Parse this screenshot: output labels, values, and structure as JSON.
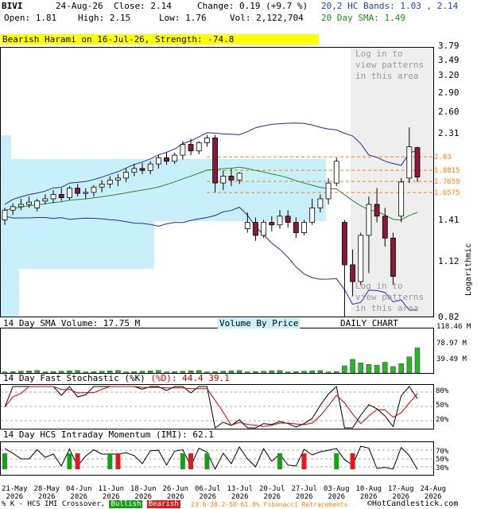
{
  "header": {
    "symbol": "BIVI",
    "date": "24-Aug-26",
    "close_label": "Close: 2.14",
    "change_label": "Change: 0.19 (+9.7 %)",
    "open_label": "Open: 1.81",
    "high_label": "High: 2.15",
    "low_label": "Low: 1.76",
    "vol_label": "Vol: 2,122,704",
    "bands_label": "20,2 HC Bands: 1.03 , 2.14",
    "sma_label": "20 Day SMA: 1.49"
  },
  "pattern_banner": "Bearish Harami on 16-Jul-26, Strength: -74.8",
  "login_notes": [
    "Log in to",
    "view patterns",
    "in this area"
  ],
  "price_axis": {
    "ticks": [
      "3.79",
      "3.49",
      "3.20",
      "2.90",
      "2.60",
      "2.31",
      "1.41",
      "1.12",
      "0.82"
    ],
    "label": "Logarithmic"
  },
  "fib_levels": [
    "2.03",
    "1.8815",
    "1.7659",
    "1.6575"
  ],
  "volume_panel": {
    "label": "14 Day SMA Volume: 17.75 M",
    "center_label": "Volume By Price",
    "right_label": "DAILY CHART",
    "ticks": [
      "118.46 M",
      "78.97 M",
      "39.49 M"
    ]
  },
  "stoch_panel": {
    "label_prefix": "14 Day Fast Stochastic (%K) ",
    "label_d": "(%D): 44.4",
    "label_d_value": "39.1",
    "ticks": [
      "80%",
      "50%",
      "20%"
    ]
  },
  "imi_panel": {
    "label": "14 Day HCS Intraday Momentum (IMI): 62.1",
    "ticks": [
      "70%",
      "50%",
      "30%"
    ]
  },
  "x_axis": {
    "dates": [
      "21-May",
      "28-May",
      "04-Jun",
      "11-Jun",
      "18-Jun",
      "26-Jun",
      "06-Jul",
      "13-Jul",
      "20-Jul",
      "27-Jul",
      "03-Aug",
      "10-Aug",
      "17-Aug",
      "24-Aug"
    ],
    "year": "2026"
  },
  "footer": {
    "legend_prefix": "% K - HCS IMI Crossover,",
    "bullish": "Bullish",
    "bearish": "Bearish",
    "fib_text": "23.6-38.2-50-61.8% Fibonacci Retracements",
    "copyright": "©HotCandlestick.com"
  },
  "colors": {
    "band_fill": "#c8f0fa",
    "up_candle": "#ffffff",
    "down_candle": "#8b1a3a",
    "sma": "#2a8a2a",
    "band_line": "#2a2aa0",
    "fib": "#ff8000",
    "volume_bar": "#2fb02f",
    "bullish": "#17a017",
    "bearish": "#e01b1b"
  },
  "chart_data": {
    "type": "candlestick",
    "y_scale": "log",
    "ylim": [
      0.82,
      3.79
    ],
    "candles": [
      [
        1.42,
        1.52,
        1.38,
        1.5
      ],
      [
        1.5,
        1.56,
        1.46,
        1.53
      ],
      [
        1.53,
        1.6,
        1.5,
        1.55
      ],
      [
        1.55,
        1.62,
        1.52,
        1.57
      ],
      [
        1.52,
        1.6,
        1.49,
        1.58
      ],
      [
        1.58,
        1.64,
        1.55,
        1.6
      ],
      [
        1.6,
        1.68,
        1.56,
        1.64
      ],
      [
        1.64,
        1.7,
        1.58,
        1.61
      ],
      [
        1.61,
        1.72,
        1.59,
        1.7
      ],
      [
        1.7,
        1.74,
        1.62,
        1.65
      ],
      [
        1.65,
        1.7,
        1.6,
        1.66
      ],
      [
        1.66,
        1.73,
        1.62,
        1.71
      ],
      [
        1.71,
        1.78,
        1.66,
        1.74
      ],
      [
        1.74,
        1.82,
        1.7,
        1.78
      ],
      [
        1.78,
        1.84,
        1.72,
        1.8
      ],
      [
        1.8,
        1.9,
        1.76,
        1.86
      ],
      [
        1.86,
        1.95,
        1.82,
        1.9
      ],
      [
        1.9,
        1.96,
        1.84,
        1.88
      ],
      [
        1.88,
        1.98,
        1.84,
        1.95
      ],
      [
        1.95,
        2.05,
        1.9,
        2.02
      ],
      [
        2.02,
        2.08,
        1.94,
        1.98
      ],
      [
        1.98,
        2.08,
        1.95,
        2.05
      ],
      [
        2.05,
        2.22,
        2.0,
        2.18
      ],
      [
        2.18,
        2.25,
        2.05,
        2.1
      ],
      [
        2.1,
        2.22,
        2.06,
        2.2
      ],
      [
        2.2,
        2.3,
        2.15,
        2.26
      ],
      [
        2.26,
        2.3,
        1.66,
        1.75
      ],
      [
        1.75,
        1.88,
        1.68,
        1.82
      ],
      [
        1.82,
        1.9,
        1.72,
        1.78
      ],
      [
        1.78,
        1.86,
        1.74,
        1.85
      ],
      [
        1.35,
        1.48,
        1.32,
        1.4
      ],
      [
        1.4,
        1.44,
        1.26,
        1.3
      ],
      [
        1.3,
        1.42,
        1.28,
        1.4
      ],
      [
        1.4,
        1.45,
        1.33,
        1.38
      ],
      [
        1.38,
        1.5,
        1.35,
        1.45
      ],
      [
        1.45,
        1.5,
        1.36,
        1.4
      ],
      [
        1.4,
        1.44,
        1.28,
        1.32
      ],
      [
        1.32,
        1.42,
        1.3,
        1.4
      ],
      [
        1.4,
        1.6,
        1.38,
        1.52
      ],
      [
        1.52,
        1.64,
        1.48,
        1.6
      ],
      [
        1.6,
        1.8,
        1.55,
        1.75
      ],
      [
        1.75,
        2.02,
        1.72,
        1.98
      ],
      [
        1.4,
        1.42,
        0.82,
        1.1
      ],
      [
        1.1,
        1.2,
        0.92,
        1.0
      ],
      [
        1.0,
        1.32,
        0.98,
        1.3
      ],
      [
        1.3,
        1.62,
        1.05,
        1.55
      ],
      [
        1.55,
        1.7,
        1.4,
        1.45
      ],
      [
        1.45,
        1.52,
        1.22,
        1.28
      ],
      [
        1.28,
        1.32,
        0.98,
        1.03
      ],
      [
        1.45,
        1.8,
        1.4,
        1.76
      ],
      [
        1.8,
        2.4,
        1.75,
        2.15
      ],
      [
        2.14,
        2.15,
        1.76,
        1.81
      ]
    ],
    "volume_ticks": [
      "118.46 M",
      "78.97 M",
      "39.49 M"
    ],
    "stochastic_k": 44.4,
    "stochastic_d": 39.1,
    "imi": 62.1
  }
}
